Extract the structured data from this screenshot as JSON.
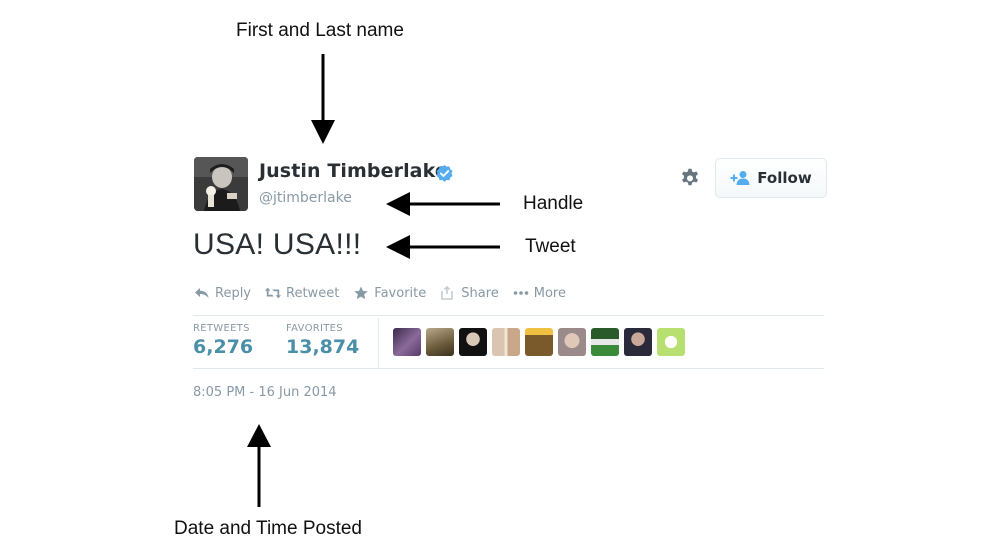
{
  "annotations": {
    "name": "First and Last name",
    "handle": "Handle",
    "tweet": "Tweet",
    "date": "Date and Time Posted"
  },
  "tweet": {
    "display_name": "Justin Timberlake",
    "handle": "@jtimberlake",
    "text": "USA! USA!!!",
    "follow_label": "Follow",
    "actions": {
      "reply": "Reply",
      "retweet": "Retweet",
      "favorite": "Favorite",
      "share": "Share",
      "more": "More"
    },
    "stats": {
      "retweets_label": "RETWEETS",
      "retweets_value": "6,276",
      "favorites_label": "FAVORITES",
      "favorites_value": "13,874"
    },
    "timestamp": "8:05 PM - 16 Jun 2014",
    "favoriters_count": 9
  },
  "colors": {
    "verified": "#55acee",
    "stat_value": "#4a8fa8",
    "muted_text": "#8899a6",
    "follow_icon": "#55acee"
  },
  "icons": [
    "verified-badge-icon",
    "gear-icon",
    "follow-user-icon",
    "reply-icon",
    "retweet-icon",
    "star-icon",
    "share-icon",
    "more-dots-icon"
  ]
}
